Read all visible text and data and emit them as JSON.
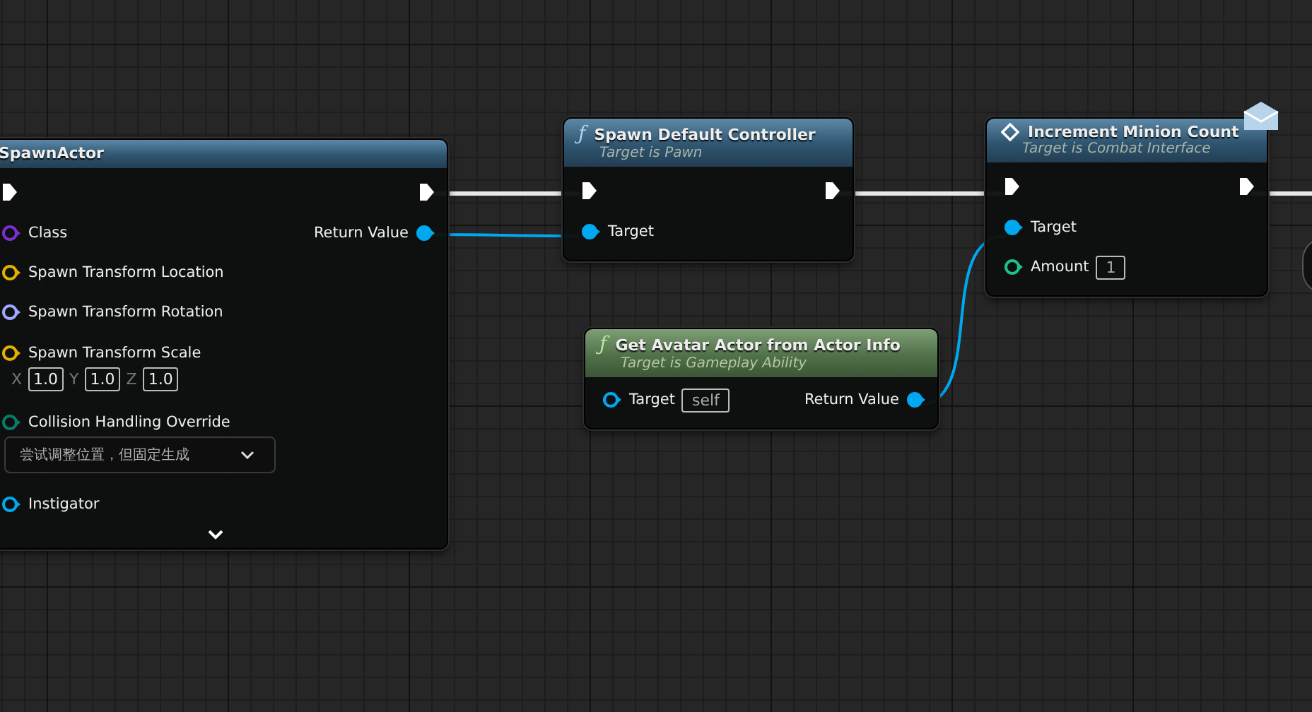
{
  "nodes": [
    {
      "kind": "function",
      "title": "SpawnActor",
      "exec": true,
      "expandable": true,
      "inputs": [
        {
          "kind": "pin",
          "label": "Class",
          "color": "#7b2fd0",
          "connected": false
        },
        {
          "kind": "pin",
          "label": "Spawn Transform Location",
          "color": "#e2b100",
          "connected": false
        },
        {
          "kind": "pin",
          "label": "Spawn Transform Rotation",
          "color": "#9ea8ff",
          "connected": false
        },
        {
          "kind": "vector",
          "label": "Spawn Transform Scale",
          "color": "#e2b100",
          "connected": false,
          "fields": [
            {
              "axis": "X",
              "value": "1.0"
            },
            {
              "axis": "Y",
              "value": "1.0"
            },
            {
              "axis": "Z",
              "value": "1.0"
            }
          ]
        },
        {
          "kind": "enum",
          "label": "Collision Handling Override",
          "color": "#0a7a6a",
          "connected": false,
          "value": "尝试调整位置，但固定生成"
        },
        {
          "kind": "pin",
          "label": "Instigator",
          "color": "#00a8f0",
          "connected": false
        }
      ],
      "outputs": [
        {
          "label": "Return Value",
          "color": "#00a8f0",
          "connected": true
        }
      ]
    },
    {
      "kind": "function",
      "icon": "ƒ",
      "title": "Spawn Default Controller",
      "subtitle": "Target is Pawn",
      "exec": true,
      "inputs": [
        {
          "kind": "pin",
          "label": "Target",
          "color": "#00a8f0",
          "connected": true
        }
      ]
    },
    {
      "kind": "pure",
      "icon": "ƒ",
      "title": "Get Avatar Actor from Actor Info",
      "subtitle": "Target is Gameplay Ability",
      "exec": false,
      "inputs": [
        {
          "kind": "pin",
          "label": "Target",
          "color": "#00a8f0",
          "connected": false,
          "value": "self"
        }
      ],
      "outputs": [
        {
          "label": "Return Value",
          "color": "#00a8f0",
          "connected": true
        }
      ]
    },
    {
      "kind": "message",
      "title": "Increment Minion Count",
      "subtitle": "Target is Combat Interface",
      "exec": true,
      "inputs": [
        {
          "kind": "pin",
          "label": "Target",
          "color": "#00a8f0",
          "connected": true
        },
        {
          "kind": "pin",
          "label": "Amount",
          "color": "#1fc08a",
          "connected": false,
          "value": "1"
        }
      ]
    }
  ]
}
